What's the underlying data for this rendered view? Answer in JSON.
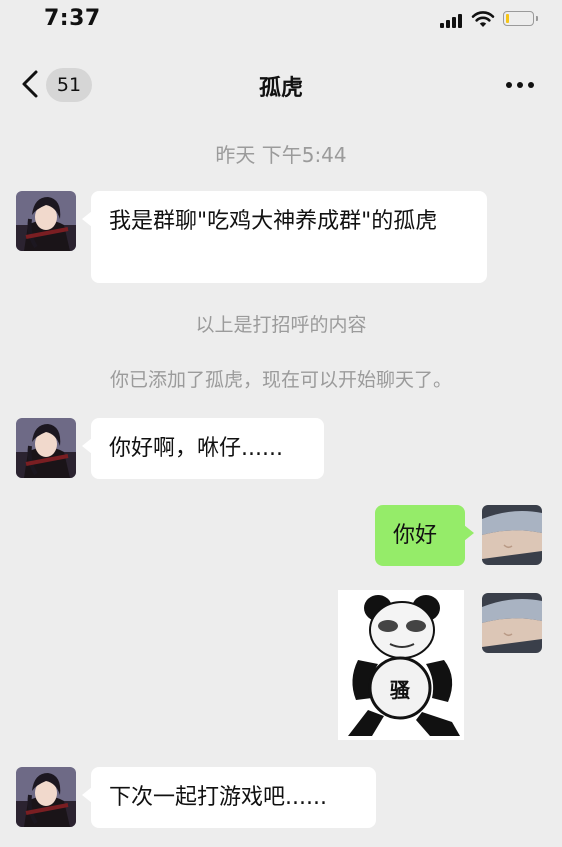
{
  "status_bar": {
    "time": "7:37",
    "battery_level": 0.12,
    "battery_color": "#f5c518"
  },
  "nav": {
    "unread_count": "51",
    "title": "孤虎",
    "more_icon": "ellipsis-icon",
    "back_icon": "chevron-left-icon"
  },
  "chat": {
    "timestamp": "昨天 下午5:44",
    "messages": [
      {
        "side": "left",
        "text": "我是群聊\"吃鸡大神养成群\"的孤虎"
      },
      {
        "side": "left",
        "text": "你好啊，咻仔......"
      },
      {
        "side": "right",
        "text": "你好"
      },
      {
        "side": "right",
        "type": "sticker",
        "sticker_text": "骚"
      },
      {
        "side": "left",
        "text": "下次一起打游戏吧......"
      }
    ],
    "system_greeting": "以上是打招呼的内容",
    "system_added": "你已添加了孤虎，现在可以开始聊天了。"
  },
  "colors": {
    "background": "#ededed",
    "sent_bubble": "#95ec69",
    "received_bubble": "#ffffff",
    "system_text": "#9b9b9b"
  }
}
